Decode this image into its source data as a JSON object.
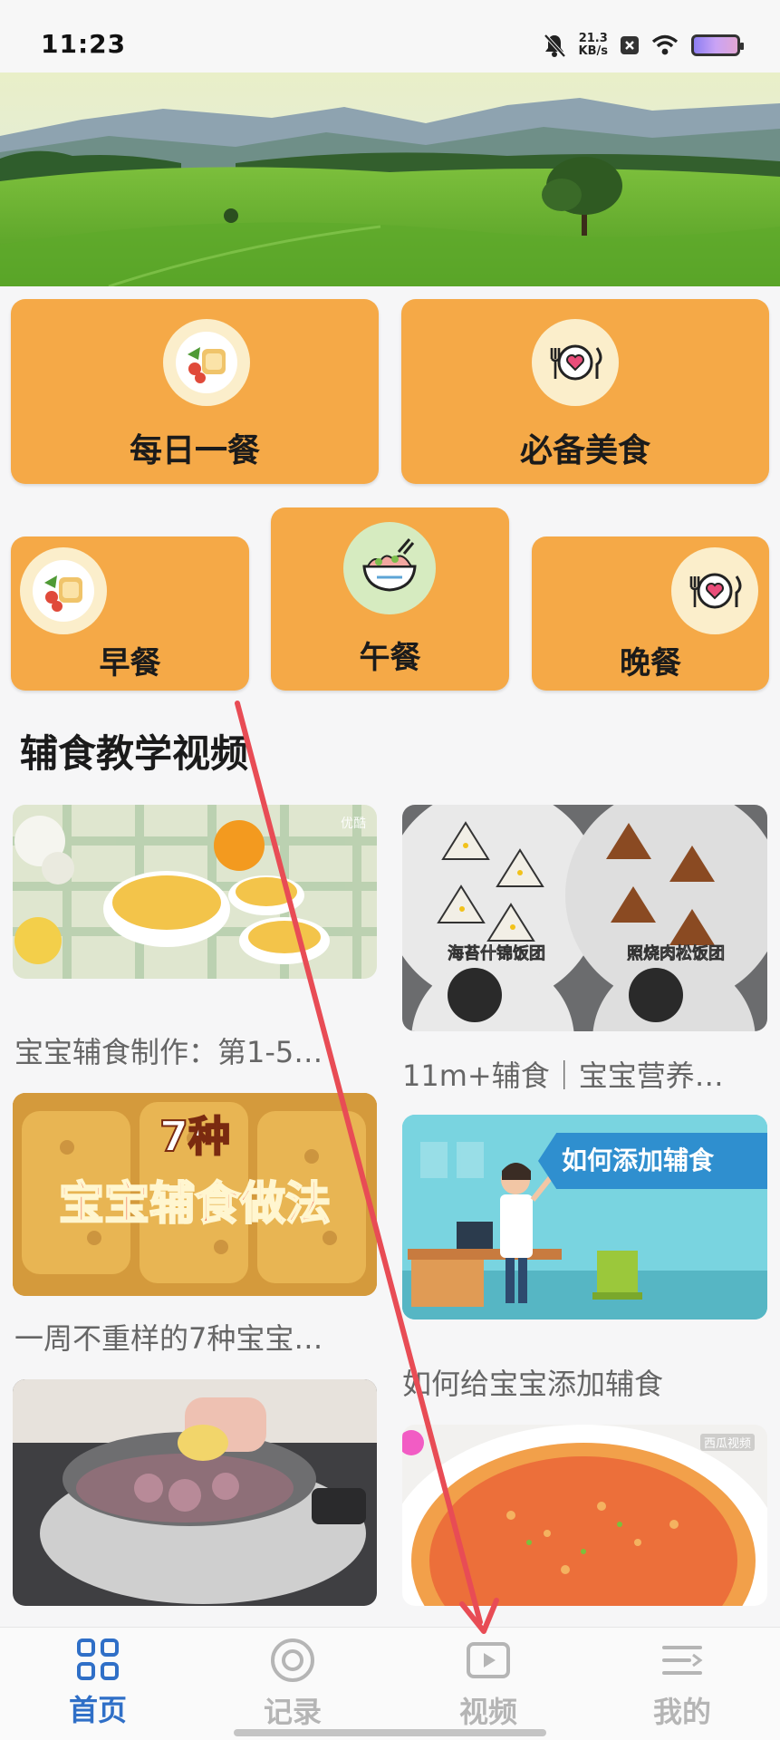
{
  "status_bar": {
    "time": "11:23",
    "net_speed_value": "21.3",
    "net_speed_unit": "KB/s",
    "icons": [
      "mute-icon",
      "net-speed",
      "notification-x-icon",
      "wifi-icon",
      "battery-icon"
    ]
  },
  "banner": {
    "description_icon": "landscape-banner"
  },
  "categories": {
    "row1": [
      {
        "label": "每日一餐",
        "icon": "toast-plate-icon"
      },
      {
        "label": "必备美食",
        "icon": "heart-plate-cutlery-icon"
      }
    ],
    "row2": [
      {
        "label": "早餐",
        "icon": "toast-plate-icon"
      },
      {
        "label": "午餐",
        "icon": "bowl-icon"
      },
      {
        "label": "晚餐",
        "icon": "heart-plate-cutlery-icon"
      }
    ]
  },
  "section": {
    "title": "辅食教学视频"
  },
  "videos": {
    "left": [
      {
        "title": "宝宝辅食制作：第1-5…",
        "watermark": "优酷"
      },
      {
        "title": "一周不重样的7种宝宝…",
        "overlay_line1": "7种",
        "overlay_line2": "宝宝辅食做法"
      },
      {
        "title": ""
      }
    ],
    "right": [
      {
        "title": "11m+辅食｜宝宝营养…",
        "caption_a": "海苔什锦饭团",
        "caption_b": "照烧肉松饭团"
      },
      {
        "title": "如何给宝宝添加辅食",
        "overlay": "如何添加辅食"
      },
      {
        "title": "",
        "watermark": "西瓜视频"
      }
    ]
  },
  "bottom_nav": {
    "items": [
      {
        "label": "首页",
        "icon": "grid-home-icon",
        "active": true
      },
      {
        "label": "记录",
        "icon": "record-circle-icon",
        "active": false
      },
      {
        "label": "视频",
        "icon": "video-play-icon",
        "active": false
      },
      {
        "label": "我的",
        "icon": "profile-menu-icon",
        "active": false
      }
    ],
    "active_color": "#2f6fc7",
    "inactive_color": "#b5b5b5"
  },
  "colors": {
    "card": "#f5a947",
    "icon_bg": "#fbeecb",
    "annotation_arrow": "#e84c55"
  }
}
